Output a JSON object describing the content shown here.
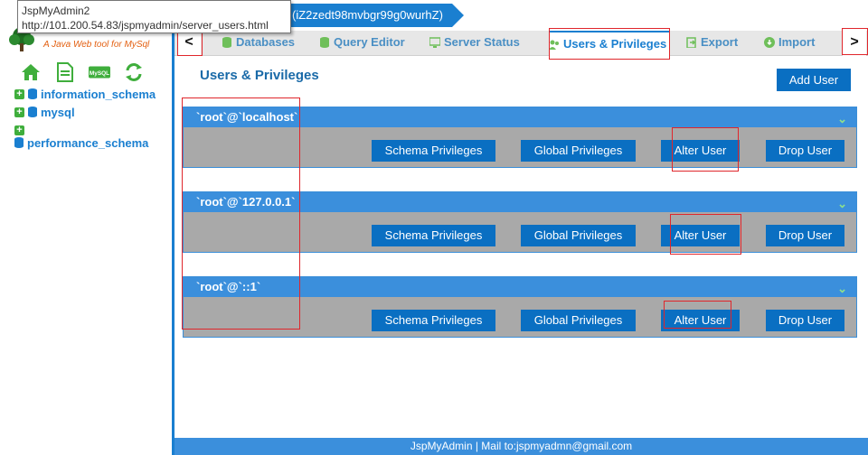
{
  "tooltip": {
    "title": "JspMyAdmin2",
    "url": "http://101.200.54.83/jspmyadmin/server_users.html"
  },
  "sidebar": {
    "tagline": "A Java Web tool for MySql",
    "mysql_icon_label": "MySQL",
    "databases": [
      {
        "name": "information_schema"
      },
      {
        "name": "mysql"
      },
      {
        "name": "performance_schema"
      }
    ]
  },
  "topbar": {
    "server": "(iZ2zedt98mvbgr99g0wurhZ)"
  },
  "nav": {
    "prev": "<",
    "next": ">"
  },
  "tabs": [
    {
      "label": "Databases",
      "icon": "database-icon"
    },
    {
      "label": "Query Editor",
      "icon": "database-icon"
    },
    {
      "label": "Server Status",
      "icon": "monitor-icon"
    },
    {
      "label": "Users & Privileges",
      "icon": "users-icon"
    },
    {
      "label": "Export",
      "icon": "export-icon"
    },
    {
      "label": "Import",
      "icon": "import-icon"
    }
  ],
  "main": {
    "title": "Users & Privileges",
    "add_user": "Add User",
    "users": [
      {
        "name": "`root`@`localhost`"
      },
      {
        "name": "`root`@`127.0.0.1`"
      },
      {
        "name": "`root`@`::1`"
      }
    ],
    "buttons": {
      "schema": "Schema Privileges",
      "global": "Global Privileges",
      "alter": "Alter User",
      "drop": "Drop User"
    }
  },
  "footer": {
    "text": "JspMyAdmin | Mail to:jspmyadmn@gmail.com"
  },
  "colors": {
    "primary": "#1a7fd0",
    "button": "#0a6fc2",
    "card": "#a9a9a9",
    "highlight": "#e0262b"
  }
}
